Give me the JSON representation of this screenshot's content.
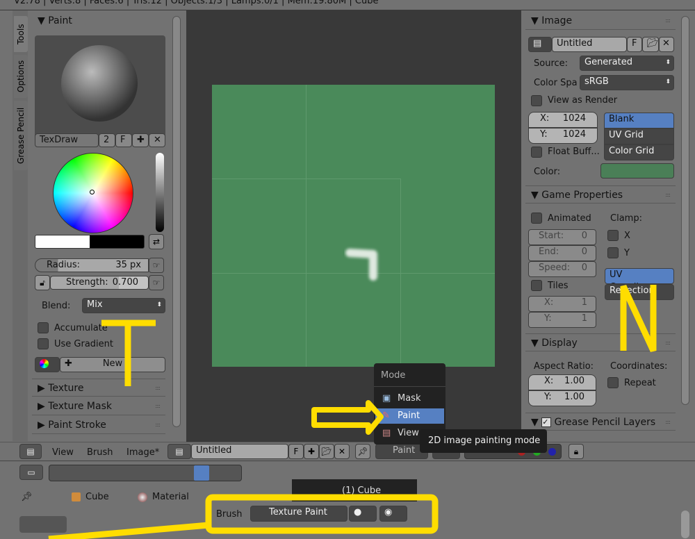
{
  "info_bar": {
    "text": "V2.78 | Verts:8 | Faces:6 | Tris:12 | Objects:1/3 | Lamps:0/1 | Mem:19.80M | Cube"
  },
  "left_tabs": [
    "Tools",
    "Options",
    "Grease Pencil"
  ],
  "tool_panel": {
    "paint_header": "Paint",
    "brush_name": "TexDraw",
    "brush_users": "2",
    "fake_user": "F",
    "radius_label": "Radius:",
    "radius_value": "35 px",
    "strength_label": "Strength:",
    "strength_value": "0.700",
    "blend_label": "Blend:",
    "blend_value": "Mix",
    "accumulate": "Accumulate",
    "use_gradient": "Use Gradient",
    "new_palette": "New",
    "sections": [
      "Texture",
      "Texture Mask",
      "Paint Stroke"
    ]
  },
  "image_panel": {
    "header": "Image",
    "image_name": "Untitled",
    "fake_user": "F",
    "source_label": "Source:",
    "source_value": "Generated",
    "colorspace_label": "Color Spa",
    "colorspace_value": "sRGB",
    "view_as_render": "View as Render",
    "x_label": "X:",
    "x_value": "1024",
    "y_label": "Y:",
    "y_value": "1024",
    "types": [
      "Blank",
      "UV Grid",
      "Color Grid"
    ],
    "selected_type": "Blank",
    "float_buffer": "Float Buff...",
    "color_label": "Color:",
    "color": "#4a7f57"
  },
  "game_properties": {
    "header": "Game Properties",
    "animated": "Animated",
    "clamp": "Clamp:",
    "clamp_x": "X",
    "clamp_y": "Y",
    "start_label": "Start:",
    "start_value": "0",
    "end_label": "End:",
    "end_value": "0",
    "speed_label": "Speed:",
    "speed_value": "0",
    "tiles": "Tiles",
    "tx_label": "X:",
    "tx_value": "1",
    "ty_label": "Y:",
    "ty_value": "1",
    "mapping": [
      "UV Coordina...",
      "Reflection"
    ],
    "selected_mapping": "UV Coordina..."
  },
  "display": {
    "header": "Display",
    "aspect_label": "Aspect Ratio:",
    "coords_label": "Coordinates:",
    "ax_label": "X:",
    "ax_value": "1.00",
    "ay_label": "Y:",
    "ay_value": "1.00",
    "repeat": "Repeat"
  },
  "grease_pencil_layers": {
    "header": "Grease Pencil Layers"
  },
  "mode_menu": {
    "title": "Mode",
    "items": [
      "Mask",
      "Paint",
      "View"
    ],
    "selected": "Paint"
  },
  "tooltip": "2D image painting mode",
  "header_bar": {
    "menus": [
      "View",
      "Brush",
      "Image*"
    ],
    "image_name": "Untitled",
    "fake_user": "F",
    "mode": "Paint"
  },
  "properties": {
    "breadcrumb": [
      "Cube",
      "Material"
    ],
    "brush_label": "Brush",
    "brush_value": "Texture Paint",
    "viewport_label": "(1) Cube"
  },
  "annotations": {
    "left_letter": "T",
    "right_letter": "N",
    "color": "#ffdd00"
  },
  "canvas_color": "#4a8a5a"
}
